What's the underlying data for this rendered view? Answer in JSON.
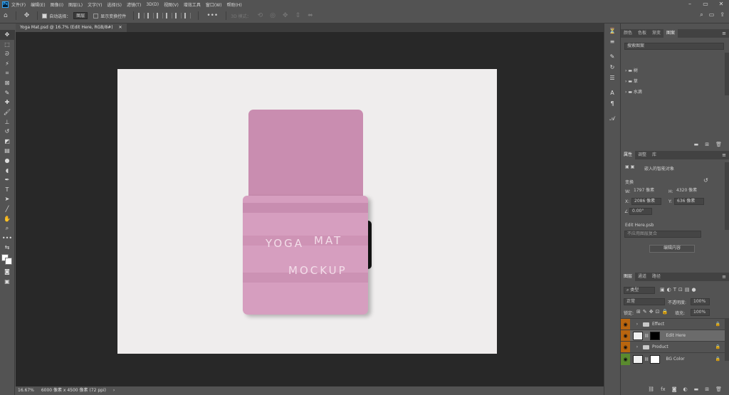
{
  "menubar": {
    "logo": "Ps",
    "items": [
      "文件(F)",
      "编辑(E)",
      "图像(I)",
      "图层(L)",
      "文字(Y)",
      "选择(S)",
      "滤镜(T)",
      "3D(D)",
      "视图(V)",
      "增效工具",
      "窗口(W)",
      "帮助(H)"
    ]
  },
  "options": {
    "auto_select_label": "自动选择：",
    "auto_select_target": "图层",
    "show_transform_label": "显示变换控件",
    "mode_3d_label": "3D 模式："
  },
  "document": {
    "tab_title": "Yoga Mat.psd @ 16.7% (Edit Here, RGB/8#)",
    "mat_line1_a": "YOGA",
    "mat_line1_b": "MAT",
    "mat_line2": "MOCKUP"
  },
  "status": {
    "zoom": "16.67%",
    "info": "6000 像素 x 4500 像素 (72 ppi)"
  },
  "libraries_panel": {
    "tabs": [
      "颜色",
      "色板",
      "渐变",
      "图案"
    ],
    "active_tab": "图案",
    "search_placeholder": "搜索图案",
    "groups": [
      "树",
      "草",
      "水滴"
    ]
  },
  "properties_panel": {
    "tabs": [
      "属性",
      "调整",
      "库"
    ],
    "active_tab": "属性",
    "object_type": "嵌入的智能对象",
    "transform_label": "变换",
    "w_label": "W:",
    "w_value": "1797 像素",
    "h_label": "H:",
    "h_value": "4320 像素",
    "x_label": "X:",
    "x_value": "2086 像素",
    "y_label": "Y:",
    "y_value": "636 像素",
    "angle_value": "0.00°",
    "linked_file": "Edit Here.psb",
    "comps_placeholder": "不应用图层复合",
    "edit_contents_button": "编辑内容"
  },
  "layers_panel": {
    "tabs": [
      "图层",
      "通道",
      "路径"
    ],
    "active_tab": "图层",
    "filter_kind": "类型",
    "blend_mode": "正常",
    "opacity_label": "不透明度:",
    "opacity_value": "100%",
    "lock_label": "锁定:",
    "fill_label": "填充:",
    "fill_value": "100%",
    "layers": [
      {
        "name": "Effect",
        "type": "group",
        "eye_color": "#b8650f"
      },
      {
        "name": "Edit Here",
        "type": "smart",
        "eye_color": "#b8650f"
      },
      {
        "name": "Product",
        "type": "group",
        "eye_color": "#b8650f"
      },
      {
        "name": "BG Color",
        "type": "fill",
        "eye_color": "#5a8a2e"
      }
    ]
  }
}
